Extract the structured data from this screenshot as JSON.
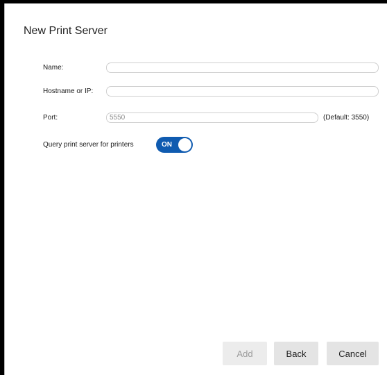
{
  "dialog": {
    "title": "New Print Server"
  },
  "form": {
    "name": {
      "label": "Name:",
      "value": "",
      "placeholder": ""
    },
    "hostname": {
      "label": "Hostname or IP:",
      "value": "",
      "placeholder": ""
    },
    "port": {
      "label": "Port:",
      "value": "5550",
      "hint": "(Default: 3550)"
    },
    "query": {
      "label": "Query print server for printers",
      "toggle_text": "ON",
      "state": "on"
    }
  },
  "buttons": {
    "add": "Add",
    "back": "Back",
    "cancel": "Cancel"
  },
  "colors": {
    "toggle_on": "#0f5bb0",
    "button_bg": "#e4e4e4",
    "disabled_text": "#9b9b9b"
  }
}
